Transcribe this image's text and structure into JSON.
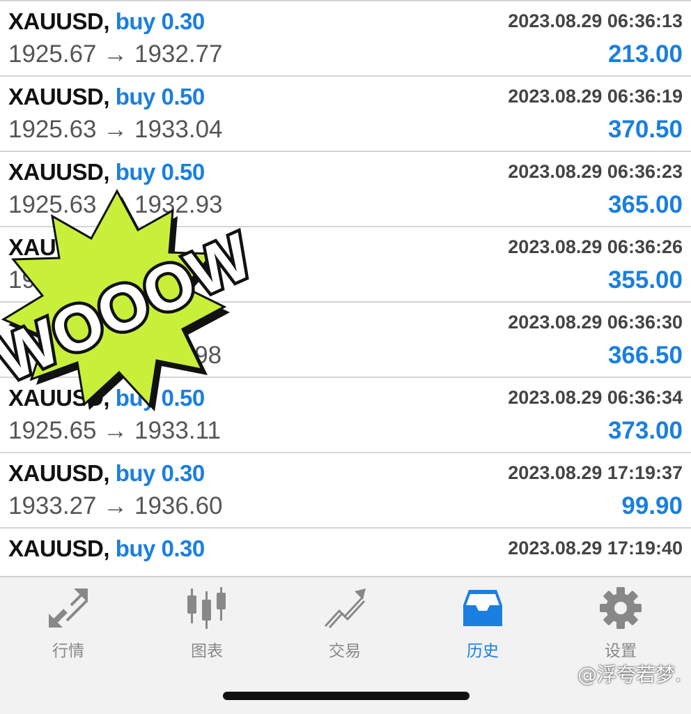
{
  "history": {
    "trades": [
      {
        "symbol": "XAUUSD,",
        "side": "buy 0.30",
        "open_price": "1925.67",
        "arrow": "→",
        "close_price": "1932.77",
        "time": "2023.08.29 06:36:13",
        "profit": "213.00"
      },
      {
        "symbol": "XAUUSD,",
        "side": "buy 0.50",
        "open_price": "1925.63",
        "arrow": "→",
        "close_price": "1933.04",
        "time": "2023.08.29 06:36:19",
        "profit": "370.50"
      },
      {
        "symbol": "XAUUSD,",
        "side": "buy 0.50",
        "open_price": "1925.63",
        "arrow": "→",
        "close_price": "1932.93",
        "time": "2023.08.29 06:36:23",
        "profit": "365.00"
      },
      {
        "symbol": "XAUUSD,",
        "side": "",
        "open_price": "19",
        "arrow": "",
        "close_price": "",
        "time": "2023.08.29 06:36:26",
        "profit": "355.00"
      },
      {
        "symbol": "",
        "side": "",
        "open_price": "",
        "arrow": "",
        "close_price": "2.98",
        "time": "2023.08.29 06:36:30",
        "profit": "366.50"
      },
      {
        "symbol": "XAUUSD,",
        "side": "buy 0.50",
        "open_price": "1925.65",
        "arrow": "→",
        "close_price": "1933.11",
        "time": "2023.08.29 06:36:34",
        "profit": "373.00"
      },
      {
        "symbol": "XAUUSD,",
        "side": "buy 0.30",
        "open_price": "1933.27",
        "arrow": "→",
        "close_price": "1936.60",
        "time": "2023.08.29 17:19:37",
        "profit": "99.90"
      },
      {
        "symbol": "XAUUSD,",
        "side": "buy 0.30",
        "open_price": "",
        "arrow": "",
        "close_price": "",
        "time": "2023.08.29 17:19:40",
        "profit": ""
      }
    ]
  },
  "sticker": {
    "text": "WOOOW",
    "icon": "comic-burst-sticker",
    "fill": "#c8f03a",
    "outline": "#111111"
  },
  "tab_bar": {
    "tabs": [
      {
        "label": "行情",
        "icon": "quotes-arrows-icon",
        "active": false
      },
      {
        "label": "图表",
        "icon": "candlestick-icon",
        "active": false
      },
      {
        "label": "交易",
        "icon": "trade-trend-icon",
        "active": false
      },
      {
        "label": "历史",
        "icon": "history-inbox-icon",
        "active": true
      },
      {
        "label": "设置",
        "icon": "gear-icon",
        "active": false
      }
    ]
  },
  "watermark": {
    "text": "@浮夸若梦."
  },
  "colors": {
    "accent": "#1a7fe0",
    "inactive": "#888888",
    "background": "#ffffff",
    "tab_bar": "#f2f2f2"
  }
}
